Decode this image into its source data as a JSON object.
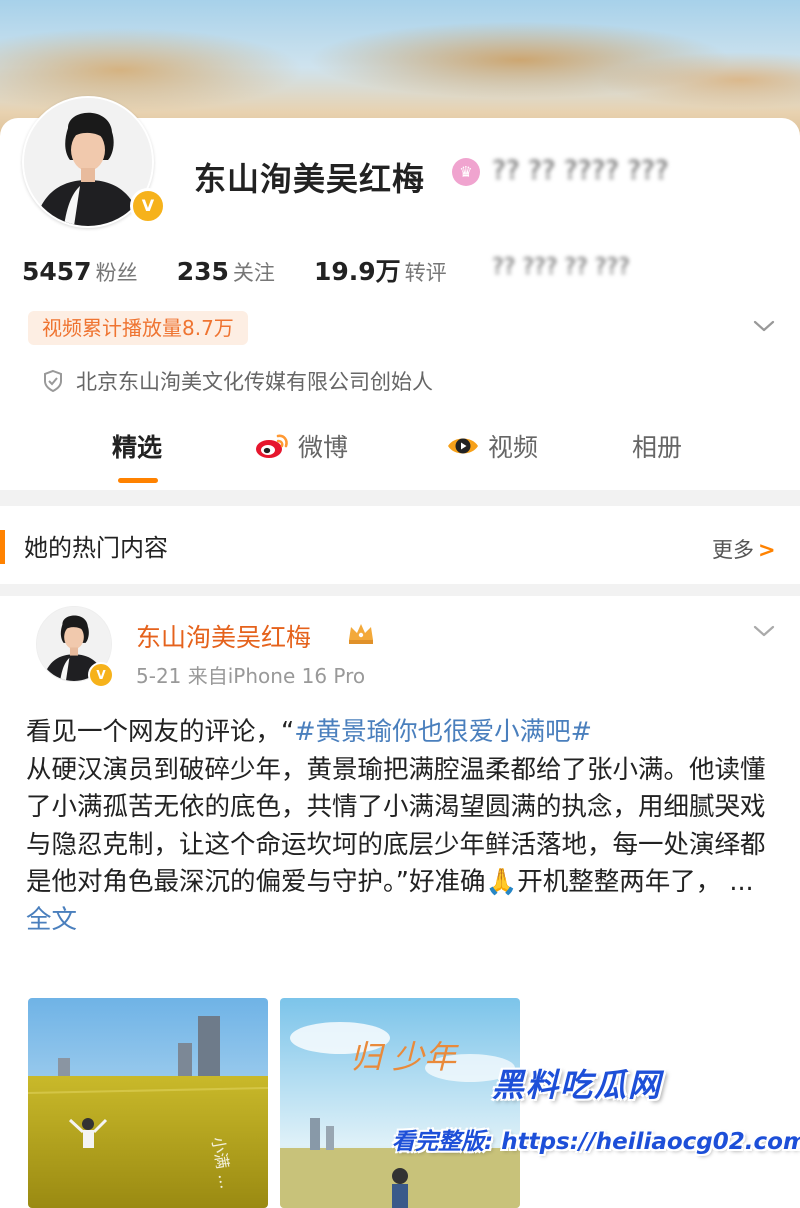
{
  "profile": {
    "name": "东山洵美吴红梅",
    "bio_blurred": "?? ?? ???? ???",
    "verified_badge": "V",
    "member_icon": "crown-badge-icon",
    "stats": [
      {
        "value": "5457",
        "label": "粉丝"
      },
      {
        "value": "235",
        "label": "关注"
      },
      {
        "value": "19.9万",
        "label": "转评"
      }
    ],
    "stats_blurred": "?? ??? ?? ???",
    "play_count_badge": "视频累计播放量8.7万",
    "company": "北京东山洵美文化传媒有限公司创始人"
  },
  "tabs": [
    {
      "label": "精选",
      "active": true
    },
    {
      "label": "微博",
      "icon": "weibo-icon"
    },
    {
      "label": "视频",
      "icon": "video-icon"
    },
    {
      "label": "相册"
    }
  ],
  "hot": {
    "title": "她的热门内容",
    "more_label": "更多",
    "more_arrow": ">"
  },
  "post": {
    "author": "东山洵美吴红梅",
    "meta": "5-21  来自iPhone 16 Pro",
    "text_before": "看见一个网友的评论，“",
    "hashtag": "#黄景瑜你也很爱小满吧#",
    "text_after": "从硬汉演员到破碎少年，黄景瑜把满腔温柔都给了张小满。他读懂了小满孤苦无依的底色，共情了小满渴望圆满的执念，用细腻哭戏与隐忍克制，让这个命运坎坷的底层少年鲜活落地，每一处演绎都是他对角色最深沉的偏爱与守护。”好准确",
    "emoji": "🙏",
    "text_end": "开机整整两年了，  ...",
    "fulltext_label": "全文",
    "image1_caption": "小满 ...",
    "image2_caption": "归 少年"
  },
  "watermark": {
    "title": "黑料吃瓜网",
    "url": "看完整版: https://heiliaocg02.com"
  },
  "colors": {
    "accent_orange": "#ff8200",
    "link_blue": "#4a7fbd",
    "author_orange": "#e5621c",
    "badge_bg": "#fdeee3",
    "verified_gold": "#f6b21b"
  }
}
